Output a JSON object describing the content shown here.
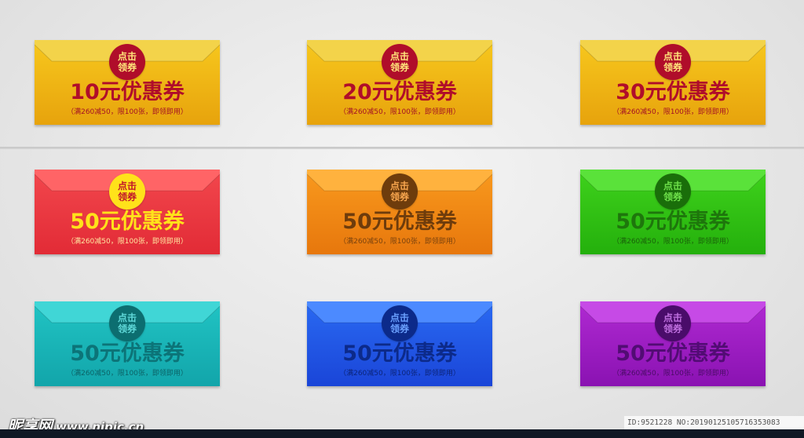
{
  "coupons": [
    {
      "seal_line1": "点击",
      "seal_line2": "领券",
      "amount": "10元优惠券",
      "terms": "（满260减50，限100张，即领即用）",
      "colors": {
        "body_top": "#f7c81e",
        "body_bottom": "#e7a30c",
        "flap": "#f3d34a",
        "seal_bg": "#b00d2a",
        "seal_text": "#ffe57a",
        "amount": "#b00d2a",
        "terms": "#a31025"
      }
    },
    {
      "seal_line1": "点击",
      "seal_line2": "领券",
      "amount": "20元优惠券",
      "terms": "（满260减50，限100张，即领即用）",
      "colors": {
        "body_top": "#f7c81e",
        "body_bottom": "#e7a30c",
        "flap": "#f3d34a",
        "seal_bg": "#b00d2a",
        "seal_text": "#ffe57a",
        "amount": "#b00d2a",
        "terms": "#a31025"
      }
    },
    {
      "seal_line1": "点击",
      "seal_line2": "领券",
      "amount": "30元优惠券",
      "terms": "（满260减50，限100张，即领即用）",
      "colors": {
        "body_top": "#f7c81e",
        "body_bottom": "#e7a30c",
        "flap": "#f3d34a",
        "seal_bg": "#b00d2a",
        "seal_text": "#ffe57a",
        "amount": "#b00d2a",
        "terms": "#a31025"
      }
    },
    {
      "seal_line1": "点击",
      "seal_line2": "领券",
      "amount": "50元优惠券",
      "terms": "（满260减50，限100张，即领即用）",
      "colors": {
        "body_top": "#f2474d",
        "body_bottom": "#e22b36",
        "flap": "#ff6466",
        "seal_bg": "#ffe21a",
        "seal_text": "#c0142a",
        "amount": "#ffe21a",
        "terms": "#ffe6a0"
      }
    },
    {
      "seal_line1": "点击",
      "seal_line2": "领券",
      "amount": "50元优惠券",
      "terms": "（满260减50，限100张，即领即用）",
      "colors": {
        "body_top": "#f99a1e",
        "body_bottom": "#e7770c",
        "flap": "#ffb23e",
        "seal_bg": "#6e3c0c",
        "seal_text": "#f7a54e",
        "amount": "#6e3c0c",
        "terms": "#7a420e"
      }
    },
    {
      "seal_line1": "点击",
      "seal_line2": "领券",
      "amount": "50元优惠券",
      "terms": "（满260减50，限100张，即领即用）",
      "colors": {
        "body_top": "#3fd21c",
        "body_bottom": "#24b00c",
        "flap": "#5ae23a",
        "seal_bg": "#1a6e0a",
        "seal_text": "#6ee04a",
        "amount": "#1e760c",
        "terms": "#1a620a"
      }
    },
    {
      "seal_line1": "点击",
      "seal_line2": "领券",
      "amount": "50元优惠券",
      "terms": "（满260减50，限100张，即领即用）",
      "colors": {
        "body_top": "#21c4c4",
        "body_bottom": "#12a5aa",
        "flap": "#40d6d6",
        "seal_bg": "#0c6e70",
        "seal_text": "#5fd8d8",
        "amount": "#0c7478",
        "terms": "#0c6266"
      }
    },
    {
      "seal_line1": "点击",
      "seal_line2": "领券",
      "amount": "50元优惠券",
      "terms": "（满260减50，限100张，即领即用）",
      "colors": {
        "body_top": "#2a6af2",
        "body_bottom": "#1a45d8",
        "flap": "#4c8aff",
        "seal_bg": "#0c2a8a",
        "seal_text": "#6aa0ff",
        "amount": "#0c2a8a",
        "terms": "#0c2478"
      }
    },
    {
      "seal_line1": "点击",
      "seal_line2": "领券",
      "amount": "50元优惠券",
      "terms": "（满260减50，限100张，即领即用）",
      "colors": {
        "body_top": "#b02ad2",
        "body_bottom": "#8a12b2",
        "flap": "#c64ae6",
        "seal_bg": "#4a0c6a",
        "seal_text": "#c070e0",
        "amount": "#520c74",
        "terms": "#4a0c66"
      }
    }
  ],
  "watermark": {
    "brand": "昵享网",
    "site": "www.nipic.cn",
    "id_info": "ID:9521228 NO:20190125105716353083"
  }
}
